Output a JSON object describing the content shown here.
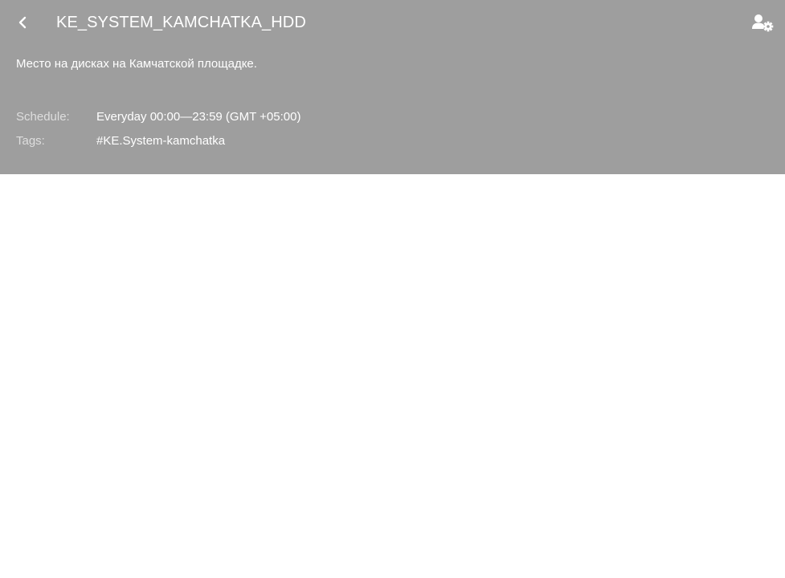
{
  "header": {
    "title": "KE_SYSTEM_KAMCHATKA_HDD",
    "back_icon": "chevron-left-icon",
    "settings_icon": "user-settings-icon",
    "background_color": "#9e9e9e",
    "text_color": "#ffffff"
  },
  "description": "Место на дисках на Камчатской площадке.",
  "meta": {
    "schedule_label": "Schedule:",
    "schedule_value": "Everyday 00:00—23:59 (GMT +05:00)",
    "tags_label": "Tags:",
    "tags_value": "#KE.System-kamchatka"
  }
}
